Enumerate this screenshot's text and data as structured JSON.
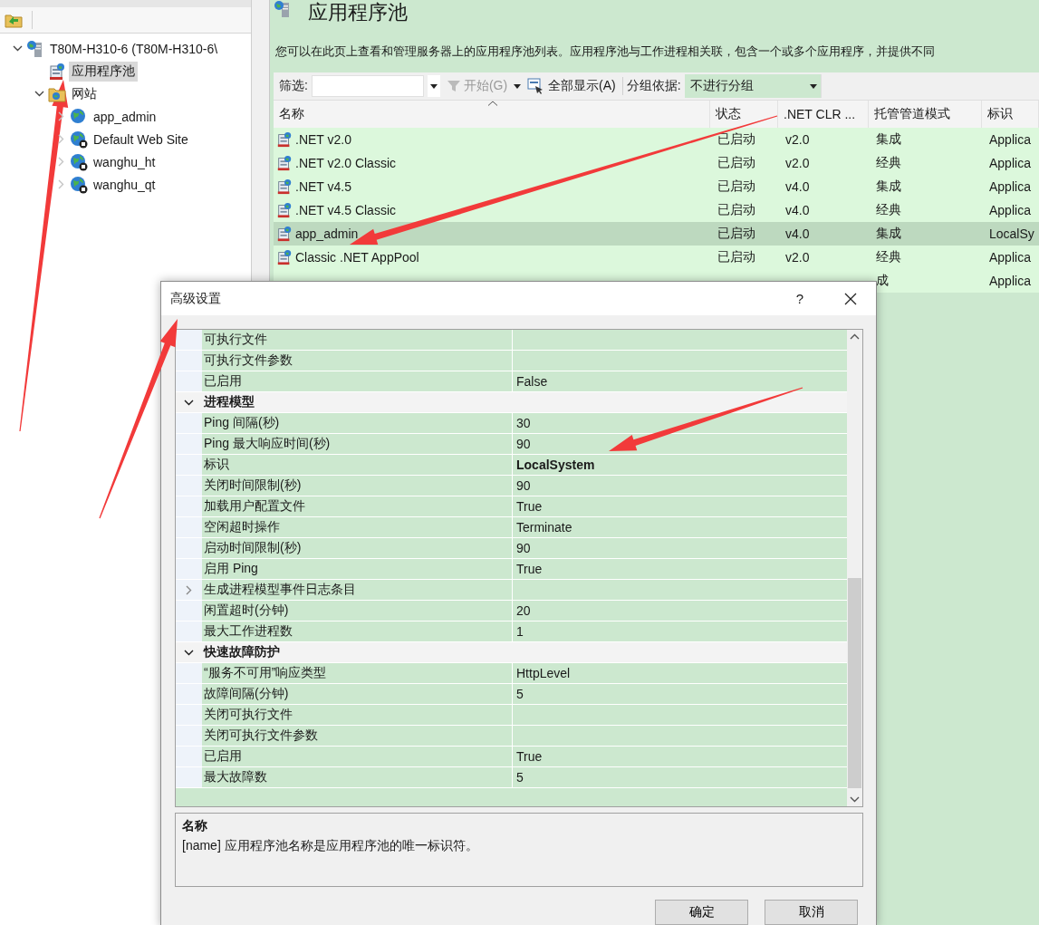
{
  "tree": {
    "nodes": [
      {
        "label": "T80M-H310-6 (T80M-H310-6\\",
        "kind": "server",
        "expanded": true,
        "selected": false,
        "children": [
          {
            "label": "应用程序池",
            "kind": "pools",
            "selected": true
          },
          {
            "label": "网站",
            "kind": "sites",
            "expanded": true,
            "selected": false,
            "children": [
              {
                "label": "app_admin",
                "kind": "site",
                "expanded": false,
                "stopped": false,
                "selected": false
              },
              {
                "label": "Default Web Site",
                "kind": "site",
                "expanded": false,
                "stopped": true,
                "selected": false
              },
              {
                "label": "wanghu_ht",
                "kind": "site",
                "expanded": false,
                "stopped": true,
                "selected": false
              },
              {
                "label": "wanghu_qt",
                "kind": "site",
                "expanded": false,
                "stopped": true,
                "selected": false
              }
            ]
          }
        ]
      }
    ]
  },
  "page": {
    "title": "应用程序池",
    "description": "您可以在此页上查看和管理服务器上的应用程序池列表。应用程序池与工作进程相关联，包含一个或多个应用程序，并提供不同"
  },
  "filter_bar": {
    "filter_label": "筛选:",
    "go_label": "开始(G)",
    "go_disabled": true,
    "show_all_label": "全部显示(A)",
    "group_label": "分组依据:",
    "group_value": "不进行分组"
  },
  "table": {
    "columns": [
      "名称",
      "状态",
      ".NET CLR ...",
      "托管管道模式",
      "标识"
    ],
    "rows": [
      {
        "name": ".NET v2.0",
        "status": "已启动",
        "clr": "v2.0",
        "pipeline": "集成",
        "identity": "Applica",
        "selected": false
      },
      {
        "name": ".NET v2.0 Classic",
        "status": "已启动",
        "clr": "v2.0",
        "pipeline": "经典",
        "identity": "Applica",
        "selected": false
      },
      {
        "name": ".NET v4.5",
        "status": "已启动",
        "clr": "v4.0",
        "pipeline": "集成",
        "identity": "Applica",
        "selected": false
      },
      {
        "name": ".NET v4.5 Classic",
        "status": "已启动",
        "clr": "v4.0",
        "pipeline": "经典",
        "identity": "Applica",
        "selected": false
      },
      {
        "name": "app_admin",
        "status": "已启动",
        "clr": "v4.0",
        "pipeline": "集成",
        "identity": "LocalSy",
        "selected": true
      },
      {
        "name": "Classic .NET AppPool",
        "status": "已启动",
        "clr": "v2.0",
        "pipeline": "经典",
        "identity": "Applica",
        "selected": false
      },
      {
        "pipeline": "成",
        "identity": "Applica",
        "selected": false
      }
    ]
  },
  "dialog": {
    "title": "高级设置",
    "help": "?",
    "properties": [
      {
        "kind": "property",
        "name": "可执行文件"
      },
      {
        "kind": "property",
        "name": "可执行文件参数"
      },
      {
        "kind": "property",
        "name": "已启用",
        "value": "False",
        "modified": false
      },
      {
        "kind": "category",
        "name": "进程模型",
        "expanded": true
      },
      {
        "kind": "property",
        "name": "Ping 间隔(秒)",
        "value": "30",
        "modified": false
      },
      {
        "kind": "property",
        "name": "Ping 最大响应时间(秒)",
        "value": "90",
        "modified": false
      },
      {
        "kind": "property",
        "name": "标识",
        "value": "LocalSystem",
        "modified": true
      },
      {
        "kind": "property",
        "name": "关闭时间限制(秒)",
        "value": "90",
        "modified": false
      },
      {
        "kind": "property",
        "name": "加载用户配置文件",
        "value": "True",
        "modified": false
      },
      {
        "kind": "property",
        "name": "空闲超时操作",
        "value": "Terminate",
        "modified": false
      },
      {
        "kind": "property",
        "name": "启动时间限制(秒)",
        "value": "90",
        "modified": false
      },
      {
        "kind": "property",
        "name": "启用 Ping",
        "value": "True",
        "modified": false
      },
      {
        "kind": "subgroup",
        "name": "生成进程模型事件日志条目",
        "expanded": false
      },
      {
        "kind": "property",
        "name": "闲置超时(分钟)",
        "value": "20",
        "modified": false
      },
      {
        "kind": "property",
        "name": "最大工作进程数",
        "value": "1",
        "modified": false
      },
      {
        "kind": "category",
        "name": "快速故障防护",
        "expanded": true
      },
      {
        "kind": "property",
        "name": "“服务不可用”响应类型",
        "value": "HttpLevel",
        "modified": false
      },
      {
        "kind": "property",
        "name": "故障间隔(分钟)",
        "value": "5",
        "modified": false
      },
      {
        "kind": "property",
        "name": "关闭可执行文件"
      },
      {
        "kind": "property",
        "name": "关闭可执行文件参数"
      },
      {
        "kind": "property",
        "name": "已启用",
        "value": "True",
        "modified": false
      },
      {
        "kind": "property",
        "name": "最大故障数",
        "value": "5",
        "modified": false
      }
    ],
    "description": {
      "title": "名称",
      "text": "[name] 应用程序池名称是应用程序池的唯一标识符。"
    },
    "buttons": [
      "确定",
      "取消"
    ]
  }
}
